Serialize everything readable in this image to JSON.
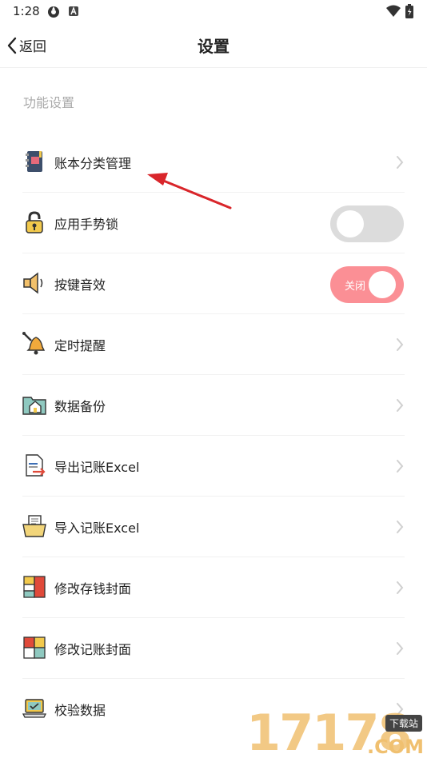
{
  "status_bar": {
    "time": "1:28"
  },
  "nav": {
    "back_label": "返回",
    "title": "设置"
  },
  "section": {
    "header": "功能设置"
  },
  "rows": [
    {
      "label": "账本分类管理",
      "icon": "notebook-icon",
      "control": "chevron"
    },
    {
      "label": "应用手势锁",
      "icon": "padlock-icon",
      "control": "toggle",
      "toggle_state": "off"
    },
    {
      "label": "按键音效",
      "icon": "speaker-icon",
      "control": "toggle",
      "toggle_state": "on",
      "toggle_text": "关闭"
    },
    {
      "label": "定时提醒",
      "icon": "bell-icon",
      "control": "chevron"
    },
    {
      "label": "数据备份",
      "icon": "folder-home-icon",
      "control": "chevron"
    },
    {
      "label": "导出记账Excel",
      "icon": "export-document-icon",
      "control": "chevron"
    },
    {
      "label": "导入记账Excel",
      "icon": "import-folder-icon",
      "control": "chevron"
    },
    {
      "label": "修改存钱封面",
      "icon": "cover-tiles-icon",
      "control": "chevron"
    },
    {
      "label": "修改记账封面",
      "icon": "cover-grid-icon",
      "control": "chevron"
    },
    {
      "label": "校验数据",
      "icon": "laptop-check-icon",
      "control": "chevron"
    }
  ],
  "watermark": {
    "digits": "17178",
    "tag": "下载站",
    "suffix": ".COM"
  },
  "colors": {
    "toggle_on": "#fb8f95",
    "toggle_off": "#dcdcdc",
    "arrow": "#d9262b",
    "section_text": "#aaaaaa"
  }
}
